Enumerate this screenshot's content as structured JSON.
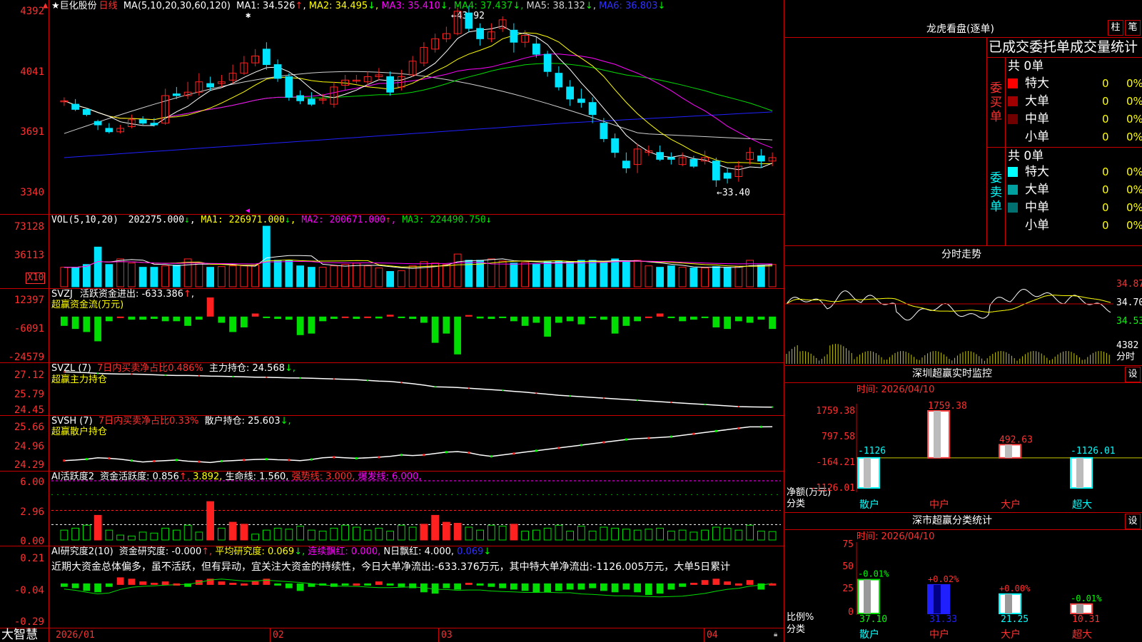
{
  "stock": {
    "name": "巨化股份",
    "period": "日线",
    "star": "★"
  },
  "colors": {
    "up": "#ff2020",
    "down": "#00e5ff",
    "grid": "#c80000",
    "text_red": "#ff3030",
    "ma1": "#ffffff",
    "ma2": "#ffff00",
    "ma3": "#ff00ff",
    "ma4": "#00dd00",
    "ma5": "#d0d0d0",
    "ma6": "#2020ff"
  },
  "main_panel": {
    "indicator_label": "MA(5,10,20,30,60,120)",
    "ma_values": [
      {
        "label": "MA1:",
        "value": "34.526",
        "arrow": "↑"
      },
      {
        "label": "MA2:",
        "value": "34.495",
        "arrow": "↓"
      },
      {
        "label": "MA3:",
        "value": "35.410",
        "arrow": "↓"
      },
      {
        "label": "MA4:",
        "value": "37.437",
        "arrow": "↓"
      },
      {
        "label": "MA5:",
        "value": "38.132",
        "arrow": "↓"
      },
      {
        "label": "MA6:",
        "value": "36.803",
        "arrow": "↓"
      }
    ],
    "y_ticks": [
      "4392",
      "4041",
      "3691",
      "3340"
    ],
    "high_mark": "43.92",
    "low_mark": "33.40"
  },
  "vol_panel": {
    "label": "VOL(5,10,20)",
    "value": "202275.000",
    "v_arrow": "↓",
    "ma": [
      {
        "label": "MA1:",
        "value": "226971.000",
        "arrow": "↓"
      },
      {
        "label": "MA2:",
        "value": "200671.000",
        "arrow": "↑"
      },
      {
        "label": "MA3:",
        "value": "224490.750",
        "arrow": "↓"
      }
    ],
    "y_ticks": [
      "73128",
      "36113"
    ],
    "unit": "X10"
  },
  "svzj_panel": {
    "label": "SVZJ",
    "text1": "活跃资金进出:",
    "value": "-633.386",
    "arrow": "↑",
    "subtitle": "超赢资金流(万元)",
    "y_ticks": [
      "12397",
      "-6091",
      "-24579"
    ]
  },
  "svzl_panel": {
    "label": "SVZL (7)",
    "text1": "7日内买卖净占比0.486%",
    "text2": "主力持仓:",
    "value": "24.568",
    "arrow": "↓,",
    "subtitle": "超赢主力持仓",
    "y_ticks": [
      "27.12",
      "25.79",
      "24.45"
    ]
  },
  "svsh_panel": {
    "label": "SVSH (7)",
    "text1": "7日内买卖净占比0.33%",
    "text2": "散户持仓:",
    "value": "25.603",
    "arrow": "↓,",
    "subtitle": "超赢散户持仓",
    "y_ticks": [
      "25.66",
      "24.96",
      "24.29"
    ]
  },
  "ai_active_panel": {
    "label": "AI活跃度2",
    "text1": "资金活跃度:",
    "v1": "0.856",
    "a1": "↑,",
    "v2": "3.892,",
    "text2": "生命线:",
    "v3": "1.560,",
    "text3": "强势线:",
    "v4": "3.000,",
    "text4": "爆发线:",
    "v5": "6.000,",
    "y_ticks": [
      "6.00",
      "2.96",
      "0.00"
    ]
  },
  "ai_research_panel": {
    "label": "AI研究度2(10)",
    "text1": "资金研究度:",
    "v1": "-0.000",
    "a1": "↑,",
    "text2": "平均研究度:",
    "v2": "0.069",
    "a2": "↓,",
    "text3": "连续飘红:",
    "v3": "0.000,",
    "text4": "N日飘红:",
    "v4": "4.000,",
    "v5": "0.069",
    "a5": "↓",
    "comment": "近期大资金总体偏多，虽不活跃，但有异动，宜关注大资金的持续性，今日大单净流出:-633.376万元，其中特大单净流出:-1126.005万元，大单5日累计",
    "y_ticks": [
      "0.21",
      "-0.04",
      "-0.29"
    ]
  },
  "x_axis": {
    "labels": [
      "2026/01",
      "02",
      "03",
      "04"
    ],
    "logo": "大智慧"
  },
  "right_panel": {
    "lhb_title": "龙虎看盘(逐单)",
    "btn_col": "柱",
    "btn_bi": "笔",
    "table_header": "已成交委托单成交量统计",
    "buy_group": {
      "label": [
        "委",
        "买",
        "单"
      ],
      "total": "共 0单",
      "rows": [
        {
          "name": "特大",
          "val": "0",
          "pct": "0%",
          "color": "#ff0000"
        },
        {
          "name": "大单",
          "val": "0",
          "pct": "0%",
          "color": "#a00000"
        },
        {
          "name": "中单",
          "val": "0",
          "pct": "0%",
          "color": "#700000"
        },
        {
          "name": "小单",
          "val": "0",
          "pct": "0%",
          "color": ""
        }
      ]
    },
    "sell_group": {
      "label": [
        "委",
        "卖",
        "单"
      ],
      "total": "共 0单",
      "rows": [
        {
          "name": "特大",
          "val": "0",
          "pct": "0%",
          "color": "#00ffff"
        },
        {
          "name": "大单",
          "val": "0",
          "pct": "0%",
          "color": "#00a0a0"
        },
        {
          "name": "中单",
          "val": "0",
          "pct": "0%",
          "color": "#007070"
        },
        {
          "name": "小单",
          "val": "0",
          "pct": "0%",
          "color": ""
        }
      ]
    },
    "intraday": {
      "title": "分时走势",
      "y_ticks": [
        "34.87",
        "34.70",
        "34.53"
      ],
      "vol_tick": "4382",
      "vol_unit": "分时"
    },
    "sz_monitor": {
      "title": "深圳超赢实时监控",
      "btn": "设",
      "date": "时间: 2026/04/10",
      "y_ticks": [
        "1759.38",
        "797.58",
        "-164.21",
        "-1126.01"
      ],
      "ylabel1": "净额(万元)",
      "ylabel2": "分类",
      "bars": [
        {
          "cat": "散户",
          "value": -1126,
          "label": "-1126"
        },
        {
          "cat": "中户",
          "value": 1759.38,
          "label": "1759.38"
        },
        {
          "cat": "大户",
          "value": 492.63,
          "label": "492.63"
        },
        {
          "cat": "超大",
          "value": -1126.01,
          "label": "-1126.01"
        }
      ]
    },
    "sz_class": {
      "title": "深市超赢分类统计",
      "btn": "设",
      "date": "时间: 2026/04/10",
      "y_ticks": [
        "75",
        "50",
        "25",
        "0"
      ],
      "ylabel1": "比例%",
      "ylabel2": "分类",
      "bars": [
        {
          "cat": "散户",
          "value": 37.1,
          "label": "37.10",
          "change": "-0.01%"
        },
        {
          "cat": "中户",
          "value": 31.33,
          "label": "31.33",
          "change": "+0.02%"
        },
        {
          "cat": "大户",
          "value": 21.25,
          "label": "21.25",
          "change": "+0.00%"
        },
        {
          "cat": "超大",
          "value": 10.31,
          "label": "10.31",
          "change": "-0.01%"
        }
      ]
    }
  },
  "chart_data": {
    "type": "candlestick",
    "price_range": [
      33.4,
      43.92
    ],
    "candles": [
      [
        38.4,
        38.4,
        38.3,
        38.1,
        38.6
      ],
      [
        38.2,
        37.9,
        38.2,
        37.8,
        38.5
      ],
      [
        37.9,
        37.6,
        37.8,
        37.5,
        38.0
      ],
      [
        37.2,
        37.0,
        37.2,
        36.7,
        37.3
      ],
      [
        36.8,
        36.6,
        36.8,
        36.5,
        37.1
      ],
      [
        36.6,
        36.8,
        36.9,
        36.5,
        37.0
      ],
      [
        36.9,
        37.3,
        37.4,
        36.8,
        37.6
      ],
      [
        37.3,
        37.1,
        37.2,
        37.0,
        37.5
      ],
      [
        37.1,
        37.0,
        37.1,
        36.9,
        37.4
      ],
      [
        37.1,
        38.7,
        38.9,
        37.0,
        39.1
      ],
      [
        38.8,
        38.7,
        38.9,
        38.5,
        39.2
      ],
      [
        38.7,
        38.9,
        39.0,
        38.5,
        39.5
      ],
      [
        38.9,
        39.5,
        39.6,
        38.7,
        40.0
      ],
      [
        39.4,
        39.2,
        39.5,
        39.0,
        39.8
      ],
      [
        39.4,
        39.5,
        39.6,
        39.2,
        39.9
      ],
      [
        39.6,
        40.0,
        40.1,
        39.4,
        40.5
      ],
      [
        40.0,
        40.6,
        40.8,
        39.9,
        41.0
      ],
      [
        40.6,
        41.0,
        41.1,
        40.4,
        41.4
      ],
      [
        41.4,
        40.5,
        41.5,
        40.2,
        41.8
      ],
      [
        40.5,
        39.7,
        40.6,
        39.5,
        40.8
      ],
      [
        39.8,
        38.6,
        39.9,
        38.4,
        40.0
      ],
      [
        38.7,
        38.4,
        38.8,
        38.2,
        39.0
      ],
      [
        38.5,
        38.2,
        38.6,
        38.1,
        38.9
      ],
      [
        38.5,
        38.5,
        38.6,
        38.2,
        38.8
      ],
      [
        38.2,
        39.2,
        39.3,
        38.0,
        39.5
      ],
      [
        39.3,
        39.6,
        39.7,
        39.0,
        39.9
      ],
      [
        39.6,
        39.6,
        39.7,
        39.4,
        39.9
      ],
      [
        39.5,
        39.8,
        39.9,
        39.3,
        40.1
      ],
      [
        39.8,
        39.9,
        40.0,
        39.6,
        40.3
      ],
      [
        39.8,
        38.9,
        39.9,
        38.7,
        40.1
      ],
      [
        39.2,
        39.8,
        39.9,
        39.0,
        40.2
      ],
      [
        39.9,
        40.7,
        40.8,
        39.8,
        41.0
      ],
      [
        40.6,
        41.5,
        41.6,
        40.4,
        41.8
      ],
      [
        41.4,
        42.0,
        42.1,
        41.2,
        42.3
      ],
      [
        42.0,
        42.3,
        42.5,
        41.8,
        42.7
      ],
      [
        42.3,
        43.6,
        43.7,
        42.2,
        43.8
      ],
      [
        43.5,
        42.6,
        43.6,
        42.4,
        43.9
      ],
      [
        42.6,
        42.0,
        42.7,
        41.6,
        42.9
      ],
      [
        42.0,
        42.4,
        42.6,
        41.8,
        42.9
      ],
      [
        42.6,
        43.1,
        43.2,
        42.4,
        43.3
      ],
      [
        42.5,
        41.8,
        42.6,
        41.2,
        42.9
      ],
      [
        41.8,
        42.2,
        42.3,
        41.5,
        42.5
      ],
      [
        41.7,
        41.1,
        41.8,
        40.9,
        42.1
      ],
      [
        41.1,
        40.1,
        41.2,
        39.8,
        41.3
      ],
      [
        40.0,
        39.2,
        40.1,
        39.0,
        40.4
      ],
      [
        39.2,
        38.5,
        39.3,
        38.1,
        39.6
      ],
      [
        38.5,
        38.3,
        38.6,
        38.0,
        39.1
      ],
      [
        38.3,
        37.6,
        38.4,
        37.1,
        38.6
      ],
      [
        37.1,
        36.2,
        37.2,
        36.0,
        37.4
      ],
      [
        36.2,
        35.4,
        36.3,
        35.1,
        36.5
      ],
      [
        34.9,
        34.5,
        35.0,
        34.2,
        35.4
      ],
      [
        34.7,
        35.6,
        35.7,
        34.2,
        35.9
      ],
      [
        35.4,
        35.5,
        35.6,
        35.2,
        35.8
      ],
      [
        35.4,
        35.0,
        35.5,
        34.9,
        35.8
      ],
      [
        35.1,
        35.0,
        35.2,
        34.7,
        35.4
      ],
      [
        34.7,
        35.1,
        35.2,
        34.6,
        35.4
      ],
      [
        35.0,
        34.6,
        35.1,
        34.5,
        35.2
      ],
      [
        34.9,
        35.1,
        35.2,
        34.7,
        35.5
      ],
      [
        34.9,
        33.8,
        35.0,
        33.4,
        35.1
      ],
      [
        34.2,
        33.9,
        34.3,
        33.6,
        34.5
      ],
      [
        34.0,
        34.6,
        34.7,
        33.7,
        34.9
      ],
      [
        35.0,
        35.4,
        35.5,
        34.7,
        35.7
      ],
      [
        35.2,
        34.9,
        35.3,
        34.5,
        35.6
      ],
      [
        34.9,
        35.1,
        35.2,
        34.6,
        35.4
      ]
    ],
    "volume": [
      28000,
      28000,
      32000,
      57000,
      32000,
      40000,
      34000,
      28000,
      28000,
      30000,
      31000,
      40000,
      34000,
      28000,
      29000,
      30000,
      30000,
      31000,
      87000,
      38000,
      38000,
      30000,
      28000,
      28000,
      30000,
      32000,
      34000,
      30000,
      27000,
      22000,
      23000,
      30000,
      36000,
      34000,
      32000,
      47000,
      38000,
      38000,
      40000,
      37000,
      34000,
      35000,
      33000,
      36000,
      37000,
      36000,
      38000,
      38000,
      35000,
      40000,
      36000,
      38000,
      30000,
      28000,
      30000,
      28000,
      27000,
      27000,
      29000,
      28000,
      29000,
      38000,
      31000,
      32000
    ],
    "svzj": [
      -6000,
      -8000,
      -10000,
      -16000,
      -3000,
      0,
      -2000,
      -2000,
      -1500,
      -3000,
      -3000,
      -6000,
      -2000,
      12397,
      -4000,
      -10000,
      -7000,
      2000,
      -1000,
      -1500,
      -2000,
      -12000,
      -11000,
      -3000,
      -1500,
      0,
      -1500,
      0,
      -1200,
      1200,
      -1000,
      -1500,
      -4000,
      -17000,
      -11000,
      -24500,
      1000,
      -1200,
      -1500,
      -1000,
      -3000,
      -6000,
      -4000,
      -13000,
      -4000,
      -3000,
      -5000,
      -1000,
      -2000,
      -11000,
      -6000,
      -3000,
      0,
      2000,
      -1000,
      -3000,
      -2000,
      -1000,
      -7000,
      -8000,
      -3000,
      -4000,
      -2000,
      -8000
    ],
    "svzl": [
      27.05,
      27.03,
      27.0,
      26.95,
      26.92,
      26.9,
      26.9,
      26.88,
      26.85,
      26.82,
      26.8,
      26.8,
      26.78,
      26.75,
      26.74,
      26.72,
      26.7,
      26.68,
      26.67,
      26.65,
      26.63,
      26.62,
      26.6,
      26.58,
      26.55,
      26.53,
      26.5,
      26.45,
      26.4,
      26.38,
      26.3,
      26.22,
      26.12,
      26.0,
      25.98,
      25.95,
      25.9,
      25.85,
      25.8,
      25.75,
      25.68,
      25.62,
      25.55,
      25.48,
      25.4,
      25.35,
      25.3,
      25.25,
      25.2,
      25.15,
      25.1,
      25.05,
      25.0,
      24.95,
      24.9,
      24.85,
      24.8,
      24.75,
      24.7,
      24.65,
      24.6,
      24.58,
      24.57,
      24.568
    ],
    "svsh": [
      24.4,
      24.42,
      24.45,
      24.5,
      24.48,
      24.45,
      24.4,
      24.35,
      24.38,
      24.4,
      24.42,
      24.38,
      24.36,
      24.33,
      24.38,
      24.4,
      24.42,
      24.44,
      24.45,
      24.43,
      24.42,
      24.4,
      24.44,
      24.5,
      24.52,
      24.5,
      24.48,
      24.5,
      24.52,
      24.55,
      24.6,
      24.58,
      24.6,
      24.65,
      24.7,
      24.72,
      24.68,
      24.6,
      24.55,
      24.6,
      24.65,
      24.7,
      24.75,
      24.8,
      24.85,
      24.9,
      24.95,
      25.0,
      25.05,
      25.1,
      25.15,
      25.18,
      25.2,
      25.22,
      25.25,
      25.3,
      25.35,
      25.4,
      25.45,
      25.5,
      25.55,
      25.6,
      25.6,
      25.603
    ],
    "ai_active": [
      1.0,
      1.2,
      1.5,
      2.5,
      1.0,
      0.5,
      0.4,
      0.8,
      0.7,
      1.2,
      1.0,
      1.5,
      0.8,
      3.892,
      1.2,
      1.8,
      1.6,
      0.6,
      1.0,
      1.2,
      1.1,
      1.4,
      1.0,
      0.9,
      1.2,
      1.5,
      1.3,
      1.0,
      1.2,
      0.9,
      1.5,
      1.3,
      1.6,
      2.5,
      1.8,
      1.7,
      1.3,
      1.0,
      1.5,
      1.4,
      1.6,
      0.9,
      1.0,
      1.2,
      1.5,
      0.9,
      1.4,
      0.9,
      1.3,
      1.2,
      1.1,
      1.0,
      1.1,
      1.2,
      0.9,
      1.0,
      0.8,
      1.0,
      1.3,
      1.2,
      1.0,
      1.5,
      0.9,
      0.856
    ],
    "ai_research": [
      -0.02,
      -0.03,
      -0.05,
      -0.06,
      -0.02,
      0.05,
      0.04,
      0.02,
      0.01,
      0.02,
      0.0,
      -0.02,
      0.03,
      0.04,
      0.02,
      0.01,
      0.0,
      0.02,
      0.04,
      -0.01,
      -0.03,
      -0.05,
      -0.02,
      -0.01,
      -0.02,
      -0.01,
      0.0,
      -0.01,
      0.02,
      -0.01,
      -0.02,
      -0.03,
      -0.06,
      -0.07,
      -0.03,
      -0.04,
      0.01,
      -0.01,
      -0.02,
      -0.03,
      -0.04,
      -0.05,
      -0.06,
      -0.06,
      -0.05,
      -0.04,
      -0.04,
      -0.03,
      -0.05,
      -0.06,
      -0.04,
      -0.06,
      -0.08,
      -0.07,
      -0.04,
      -0.02,
      0.01,
      0.03,
      0.04,
      0.02,
      0.0,
      0.03,
      -0.04,
      0.0
    ]
  }
}
